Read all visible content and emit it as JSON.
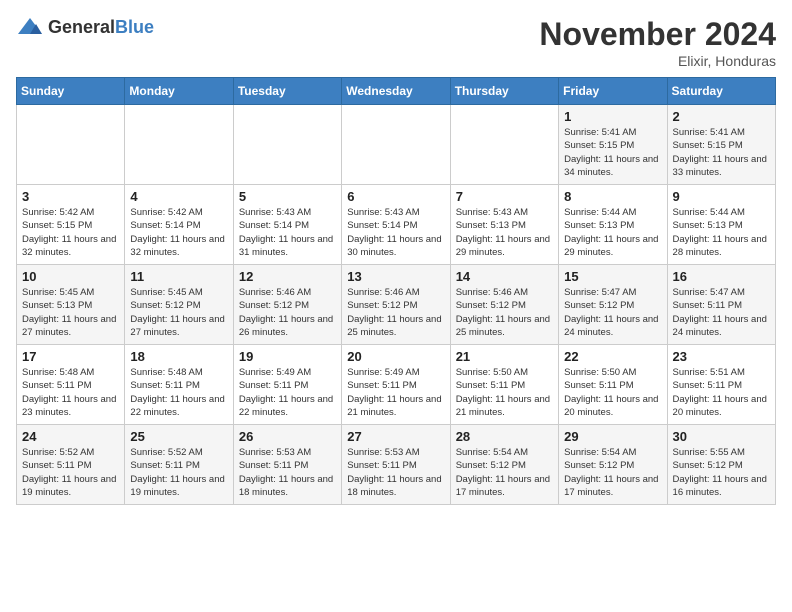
{
  "header": {
    "logo_general": "General",
    "logo_blue": "Blue",
    "month_title": "November 2024",
    "location": "Elixir, Honduras"
  },
  "days_of_week": [
    "Sunday",
    "Monday",
    "Tuesday",
    "Wednesday",
    "Thursday",
    "Friday",
    "Saturday"
  ],
  "weeks": [
    [
      {
        "day": "",
        "info": ""
      },
      {
        "day": "",
        "info": ""
      },
      {
        "day": "",
        "info": ""
      },
      {
        "day": "",
        "info": ""
      },
      {
        "day": "",
        "info": ""
      },
      {
        "day": "1",
        "info": "Sunrise: 5:41 AM\nSunset: 5:15 PM\nDaylight: 11 hours and 34 minutes."
      },
      {
        "day": "2",
        "info": "Sunrise: 5:41 AM\nSunset: 5:15 PM\nDaylight: 11 hours and 33 minutes."
      }
    ],
    [
      {
        "day": "3",
        "info": "Sunrise: 5:42 AM\nSunset: 5:15 PM\nDaylight: 11 hours and 32 minutes."
      },
      {
        "day": "4",
        "info": "Sunrise: 5:42 AM\nSunset: 5:14 PM\nDaylight: 11 hours and 32 minutes."
      },
      {
        "day": "5",
        "info": "Sunrise: 5:43 AM\nSunset: 5:14 PM\nDaylight: 11 hours and 31 minutes."
      },
      {
        "day": "6",
        "info": "Sunrise: 5:43 AM\nSunset: 5:14 PM\nDaylight: 11 hours and 30 minutes."
      },
      {
        "day": "7",
        "info": "Sunrise: 5:43 AM\nSunset: 5:13 PM\nDaylight: 11 hours and 29 minutes."
      },
      {
        "day": "8",
        "info": "Sunrise: 5:44 AM\nSunset: 5:13 PM\nDaylight: 11 hours and 29 minutes."
      },
      {
        "day": "9",
        "info": "Sunrise: 5:44 AM\nSunset: 5:13 PM\nDaylight: 11 hours and 28 minutes."
      }
    ],
    [
      {
        "day": "10",
        "info": "Sunrise: 5:45 AM\nSunset: 5:13 PM\nDaylight: 11 hours and 27 minutes."
      },
      {
        "day": "11",
        "info": "Sunrise: 5:45 AM\nSunset: 5:12 PM\nDaylight: 11 hours and 27 minutes."
      },
      {
        "day": "12",
        "info": "Sunrise: 5:46 AM\nSunset: 5:12 PM\nDaylight: 11 hours and 26 minutes."
      },
      {
        "day": "13",
        "info": "Sunrise: 5:46 AM\nSunset: 5:12 PM\nDaylight: 11 hours and 25 minutes."
      },
      {
        "day": "14",
        "info": "Sunrise: 5:46 AM\nSunset: 5:12 PM\nDaylight: 11 hours and 25 minutes."
      },
      {
        "day": "15",
        "info": "Sunrise: 5:47 AM\nSunset: 5:12 PM\nDaylight: 11 hours and 24 minutes."
      },
      {
        "day": "16",
        "info": "Sunrise: 5:47 AM\nSunset: 5:11 PM\nDaylight: 11 hours and 24 minutes."
      }
    ],
    [
      {
        "day": "17",
        "info": "Sunrise: 5:48 AM\nSunset: 5:11 PM\nDaylight: 11 hours and 23 minutes."
      },
      {
        "day": "18",
        "info": "Sunrise: 5:48 AM\nSunset: 5:11 PM\nDaylight: 11 hours and 22 minutes."
      },
      {
        "day": "19",
        "info": "Sunrise: 5:49 AM\nSunset: 5:11 PM\nDaylight: 11 hours and 22 minutes."
      },
      {
        "day": "20",
        "info": "Sunrise: 5:49 AM\nSunset: 5:11 PM\nDaylight: 11 hours and 21 minutes."
      },
      {
        "day": "21",
        "info": "Sunrise: 5:50 AM\nSunset: 5:11 PM\nDaylight: 11 hours and 21 minutes."
      },
      {
        "day": "22",
        "info": "Sunrise: 5:50 AM\nSunset: 5:11 PM\nDaylight: 11 hours and 20 minutes."
      },
      {
        "day": "23",
        "info": "Sunrise: 5:51 AM\nSunset: 5:11 PM\nDaylight: 11 hours and 20 minutes."
      }
    ],
    [
      {
        "day": "24",
        "info": "Sunrise: 5:52 AM\nSunset: 5:11 PM\nDaylight: 11 hours and 19 minutes."
      },
      {
        "day": "25",
        "info": "Sunrise: 5:52 AM\nSunset: 5:11 PM\nDaylight: 11 hours and 19 minutes."
      },
      {
        "day": "26",
        "info": "Sunrise: 5:53 AM\nSunset: 5:11 PM\nDaylight: 11 hours and 18 minutes."
      },
      {
        "day": "27",
        "info": "Sunrise: 5:53 AM\nSunset: 5:11 PM\nDaylight: 11 hours and 18 minutes."
      },
      {
        "day": "28",
        "info": "Sunrise: 5:54 AM\nSunset: 5:12 PM\nDaylight: 11 hours and 17 minutes."
      },
      {
        "day": "29",
        "info": "Sunrise: 5:54 AM\nSunset: 5:12 PM\nDaylight: 11 hours and 17 minutes."
      },
      {
        "day": "30",
        "info": "Sunrise: 5:55 AM\nSunset: 5:12 PM\nDaylight: 11 hours and 16 minutes."
      }
    ]
  ]
}
